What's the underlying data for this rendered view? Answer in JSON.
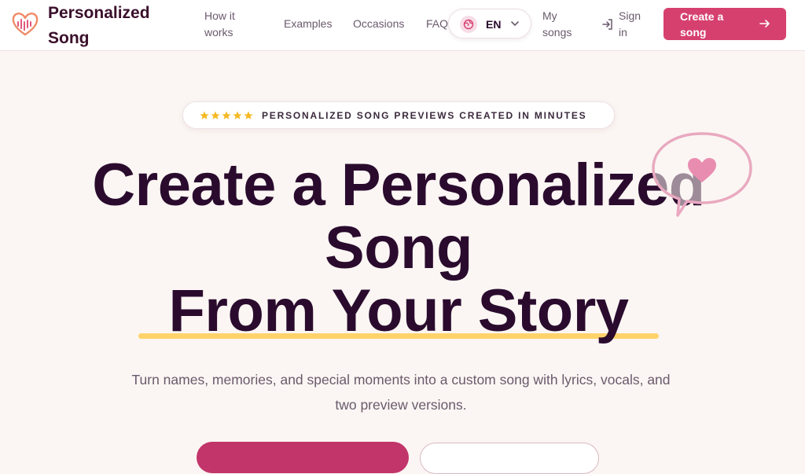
{
  "header": {
    "brand": "Personalized Song",
    "nav": {
      "how_it_works": "How it works",
      "examples": "Examples",
      "occasions": "Occasions",
      "faq": "FAQ",
      "my_songs": "My songs",
      "sign_in": "Sign in"
    },
    "language": "EN",
    "cta_label": "Create a song",
    "icons": [
      "heart-wave-logo-icon",
      "globe-icon",
      "chevron-down-icon",
      "sign-in-icon",
      "arrow-right-icon"
    ]
  },
  "hero": {
    "badge": {
      "stars": 5,
      "text": "PERSONALIZED SONG PREVIEWS CREATED IN MINUTES"
    },
    "headline": {
      "line1": "Create a Personalized",
      "line2": "Song",
      "line3": "From Your Story"
    },
    "subtitle": "Turn names, memories, and special moments into a custom song with lyrics, vocals, and two preview versions."
  },
  "colors": {
    "accent": "#d6406f",
    "headline": "#2a0b2e",
    "highlight": "#ffd36b",
    "star": "#f5b925",
    "bubble": "#e9a9c0"
  }
}
